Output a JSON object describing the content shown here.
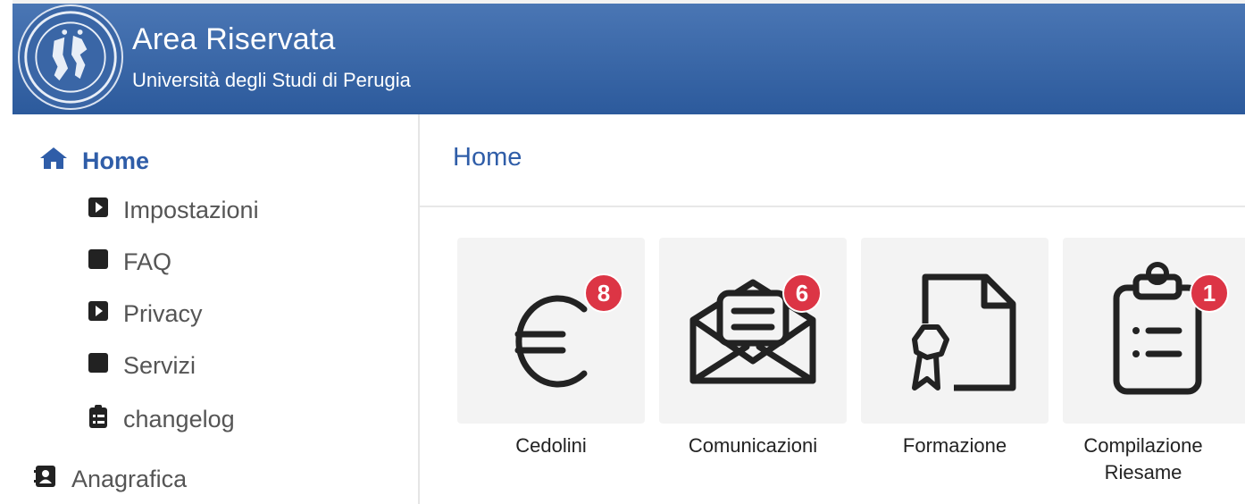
{
  "header": {
    "title": "Area Riservata",
    "subtitle": "Università degli Studi di Perugia",
    "color": "#2f5da8"
  },
  "sidebar": {
    "home": {
      "label": "Home",
      "icon": "home-icon"
    },
    "items": [
      {
        "label": "Impostazioni",
        "icon": "caret-square-icon"
      },
      {
        "label": "FAQ",
        "icon": "square-icon"
      },
      {
        "label": "Privacy",
        "icon": "caret-square-icon"
      },
      {
        "label": "Servizi",
        "icon": "square-icon"
      },
      {
        "label": "changelog",
        "icon": "clipboard-list-icon"
      }
    ],
    "anagrafica": {
      "label": "Anagrafica",
      "icon": "address-card-icon"
    }
  },
  "main": {
    "title": "Home",
    "tiles": [
      {
        "label": "Cedolini",
        "badge": "8",
        "icon": "euro-icon"
      },
      {
        "label": "Comunicazioni",
        "badge": "6",
        "icon": "envelope-open-icon"
      },
      {
        "label": "Formazione",
        "badge": "",
        "icon": "certificate-icon"
      },
      {
        "label": "Compilazione Riesame",
        "line1": "Compilazione",
        "line2": "Riesame",
        "badge": "1",
        "icon": "clipboard-list-icon"
      }
    ]
  },
  "colors": {
    "accent": "#2f5da8",
    "badge": "#dc3545",
    "tile_bg": "#f3f3f3"
  }
}
